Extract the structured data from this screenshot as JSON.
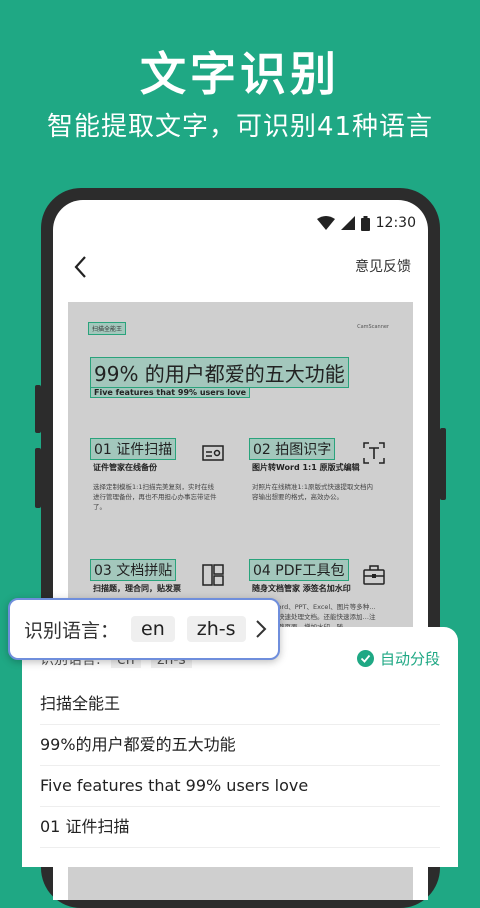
{
  "hero": {
    "title": "文字识别",
    "subtitle": "智能提取文字，可识别41种语言"
  },
  "status_bar": {
    "time": "12:30",
    "icons": [
      "wifi-icon",
      "signal-icon",
      "battery-icon"
    ]
  },
  "nav": {
    "back_icon": "back-arrow-icon",
    "feedback": "意见反馈"
  },
  "document": {
    "tag": "扫描全能王",
    "brand": "CamScanner",
    "title": "99% 的用户都爱的五大功能",
    "subtitle": "Five features that 99% users love",
    "features": [
      {
        "title": "01 证件扫描",
        "subtitle": "证件管家在线备份",
        "body": "选择定制模板1:1扫描完美复刻，实时在线进行管理备份，再也不用担心办事忘带证件了。",
        "icon": "id-card-icon"
      },
      {
        "title": "02 拍图识字",
        "subtitle": "图片转Word 1:1 原版式编辑",
        "body": "对照片在线精准1:1原版式快速提取文档内容输出想要的格式，高效办公。",
        "icon": "text-scan-icon"
      },
      {
        "title": "03 文档拼贴",
        "subtitle": "扫描题，理合同，贴发票",
        "body": "",
        "icon": "layout-icon"
      },
      {
        "title": "04 PDF工具包",
        "subtitle": "随身文档管家 添签名加水印",
        "body": "…转成Word、PPT、Excel、图片等多种…行编辑，快速处理文档。还能快速添加…注修改，调整页面，增加水印，随",
        "icon": "toolbox-icon"
      }
    ]
  },
  "sheet": {
    "language_label": "识别语言:",
    "languages": [
      "en",
      "zh-s"
    ],
    "auto_segment": "自动分段",
    "lines": [
      "扫描全能王",
      "99%的用户都爱的五大功能",
      "Five features that 99% users love",
      "01 证件扫描"
    ]
  },
  "popup": {
    "label": "识别语言：",
    "chips": [
      "en",
      "zh-s"
    ]
  },
  "colors": {
    "brand": "#1fa884",
    "highlight": "#2aa37c",
    "popup_border": "#6f8edc"
  }
}
